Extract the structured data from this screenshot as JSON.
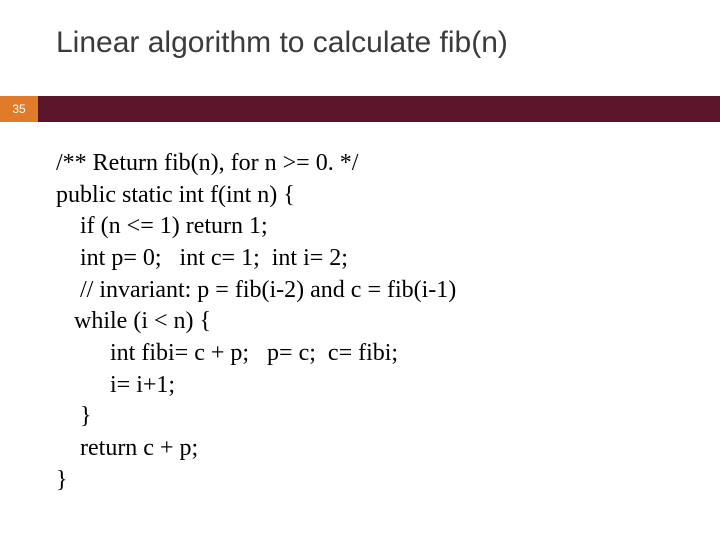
{
  "title": "Linear algorithm to calculate fib(n)",
  "slide_number": "35",
  "code": {
    "l1": "/** Return fib(n), for n >= 0. */",
    "l2": "public static int f(int n) {",
    "l3": "    if (n <= 1) return 1;",
    "l4": "    int p= 0;   int c= 1;  int i= 2;",
    "l5": "    // invariant: p = fib(i-2) and c = fib(i-1)",
    "l6": "   while (i < n) {",
    "l7": "         int fibi= c + p;   p= c;  c= fibi;",
    "l8": "         i= i+1;",
    "l9": "    }",
    "l10": "    return c + p;",
    "l11": "}"
  }
}
